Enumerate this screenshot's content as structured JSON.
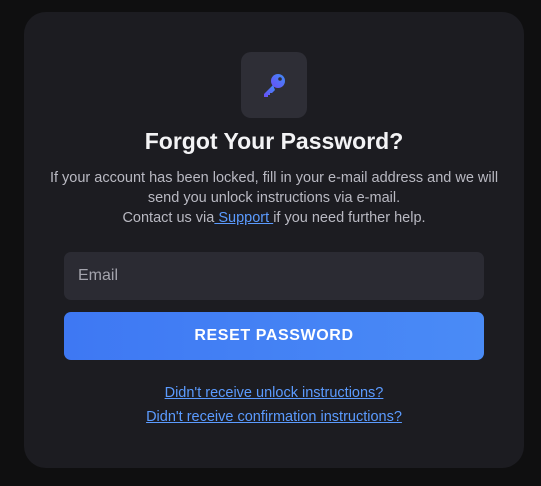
{
  "header": {
    "icon": "key-icon",
    "title": "Forgot Your Password?"
  },
  "description": {
    "line1": "If your account has been locked, fill in your e-mail address and we will send you unlock instructions via e-mail.",
    "line2_prefix": "Contact us via",
    "support_link": " Support ",
    "line2_suffix": "if you need further help."
  },
  "form": {
    "email_placeholder": "Email",
    "email_value": "",
    "reset_button": "RESET PASSWORD"
  },
  "links": {
    "unlock": "Didn't receive unlock instructions?",
    "confirmation": "Didn't receive confirmation instructions?"
  },
  "colors": {
    "background": "#0f0f10",
    "card": "#1c1c21",
    "accent": "#4a8bf6",
    "link": "#5b9bff"
  }
}
